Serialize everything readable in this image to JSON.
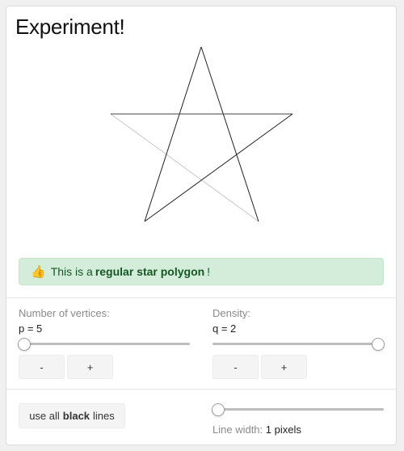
{
  "title": "Experiment!",
  "star": {
    "p": 5,
    "q": 2,
    "line_color": "#222222",
    "faint_color": "#bdbdbd"
  },
  "alert": {
    "icon": "thumbs-up-icon",
    "prefix": "This is a",
    "emphasis": "regular star polygon",
    "suffix": "!"
  },
  "vertices": {
    "label": "Number of vertices:",
    "value_text": "p = 5",
    "slider_fraction": 0.0,
    "minus_label": "-",
    "plus_label": "+"
  },
  "density": {
    "label": "Density:",
    "value_text": "q = 2",
    "slider_fraction": 1.0,
    "minus_label": "-",
    "plus_label": "+"
  },
  "black_lines_button": {
    "prefix": "use all",
    "emphasis": "black",
    "suffix": "lines"
  },
  "line_width": {
    "label": "Line width:",
    "value_text": "1 pixels",
    "slider_fraction": 0.0
  },
  "colors": {
    "alert_bg": "#d4edda",
    "alert_text": "#155724"
  }
}
